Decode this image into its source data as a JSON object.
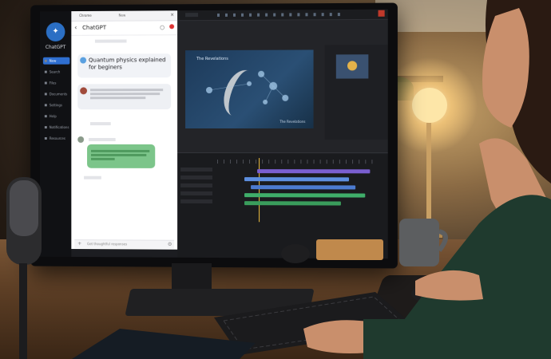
{
  "photo": {
    "description_alt": ""
  },
  "chat_app": {
    "brand": "ChatGPT",
    "browser_tab": "Chrome",
    "browser_tab_2": "New",
    "header_title": "ChatGPT",
    "user_prompt": "Quantum physics explained for beginers",
    "sidebar_items": [
      "New",
      "Search",
      "Files",
      "Documents",
      "Settings",
      "Help",
      "Notifications",
      "Resources"
    ],
    "input_placeholder": "Get thoughtful responses"
  },
  "video_editor": {
    "preview_title": "The Revelations",
    "preview_caption": "The Revelations"
  },
  "colors": {
    "chat_green": "#7cc58a",
    "sidebar_active": "#2f6fd1",
    "editor_bg": "#232428",
    "warm_light": "#f4c77a"
  }
}
